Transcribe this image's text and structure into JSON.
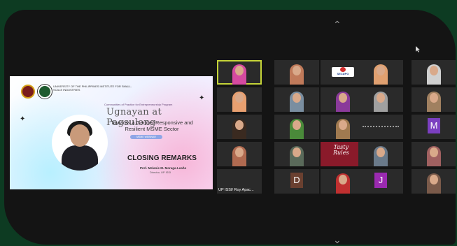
{
  "slide": {
    "institute": "UNIVERSITY OF THE PHILIPPINES INSTITUTE FOR SMALL-SCALE INDUSTRIES",
    "program": "Communities of Practice for Entrepreneurship Program",
    "title": "Ugnayan at Pagsulong",
    "subtitle_line1": "Towards a Gender-Responsive and",
    "subtitle_line2": "Resilient MSME Sector",
    "pill": "MSME WEBINAR",
    "section": "CLOSING REMARKS",
    "speaker": "Prof. Melanie M. Moraga-Leaño",
    "role": "Director, UP ISSI"
  },
  "gallery": {
    "tiles": [
      {
        "type": "person",
        "color": "#d64aa0",
        "active": true
      },
      {
        "type": "person",
        "color": "#c07a5a"
      },
      {
        "type": "secdpo",
        "label": "SECDPO"
      },
      {
        "type": "person",
        "color": "#e0a070"
      },
      {
        "type": "person",
        "color": "#d0d0d0"
      },
      {
        "type": "person",
        "color": "#e8a070"
      },
      {
        "type": "person",
        "color": "#7a8ea0"
      },
      {
        "type": "person",
        "color": "#8a3a9a"
      },
      {
        "type": "person",
        "color": "#a0a0a0"
      },
      {
        "type": "person",
        "color": "#a08060"
      },
      {
        "type": "person",
        "color": "#3a2a20"
      },
      {
        "type": "person",
        "color": "#4a8a3a"
      },
      {
        "type": "person",
        "color": "#a07a50"
      },
      {
        "type": "dots"
      },
      {
        "type": "letter",
        "letter": "M",
        "color": "#7b3fc0"
      },
      {
        "type": "person",
        "color": "#b06a50"
      },
      {
        "type": "person",
        "color": "#5a6a5a"
      },
      {
        "type": "tasty",
        "line1": "Tasty",
        "line2": "Rules"
      },
      {
        "type": "person",
        "color": "#6a7a8a"
      },
      {
        "type": "person",
        "color": "#a06060"
      },
      {
        "type": "labeled",
        "label": "UP ISSI/ Roy Apac..."
      },
      {
        "type": "letter",
        "letter": "D",
        "color": "#6a4030"
      },
      {
        "type": "person",
        "color": "#c03030"
      },
      {
        "type": "letter",
        "letter": "J",
        "color": "#9a2ab0"
      },
      {
        "type": "person",
        "color": "#7a5a4a"
      }
    ]
  }
}
